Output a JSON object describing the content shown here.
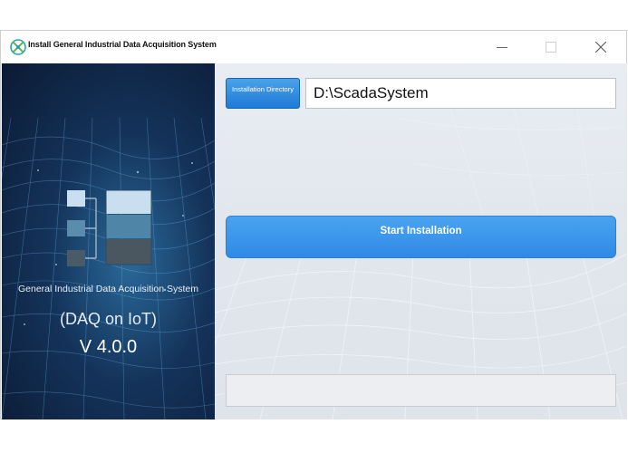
{
  "window": {
    "title": "Install General Industrial Data Acquisition System",
    "controls": {
      "minimize_icon": "minimize-icon",
      "maximize_icon": "maximize-icon",
      "close_icon": "close-icon"
    }
  },
  "left_panel": {
    "product_name": "General Industrial Data Acquisition System",
    "subtitle": "(DAQ on IoT)",
    "version": "V 4.0.0"
  },
  "right_panel": {
    "directory_button_label": "Installation Directory",
    "directory_value": "D:\\ScadaSystem",
    "start_button_label": "Start Installation",
    "progress_fraction": 0
  },
  "colors": {
    "accent": "#2f8ae6",
    "button_dark": "#1e7bd6",
    "left_panel_bg": "#14335a"
  }
}
